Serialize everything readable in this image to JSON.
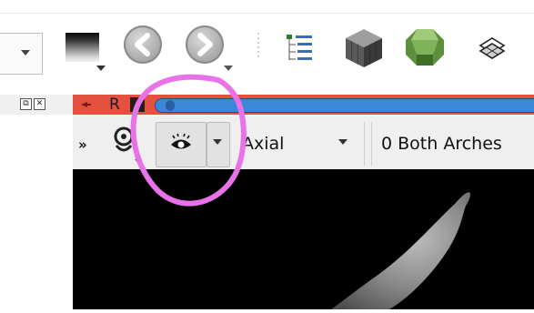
{
  "toolbar": {
    "icons": [
      "dropdown",
      "window-level-gradient-icon",
      "back-arrow-icon",
      "forward-arrow-icon",
      "tree-list-icon",
      "cube-icon",
      "gem-icon",
      "layers-icon"
    ]
  },
  "view_controller": {
    "corner": {
      "restore_label": "⧉",
      "close_label": "✕"
    },
    "slice_label": "R",
    "chevrons": "»",
    "orientation": "Axial",
    "volume": "0 Both Arches"
  },
  "colors": {
    "slice_bar": "#e4513f",
    "slider_track": "#3b88d6",
    "annotation": "#e873e8"
  }
}
